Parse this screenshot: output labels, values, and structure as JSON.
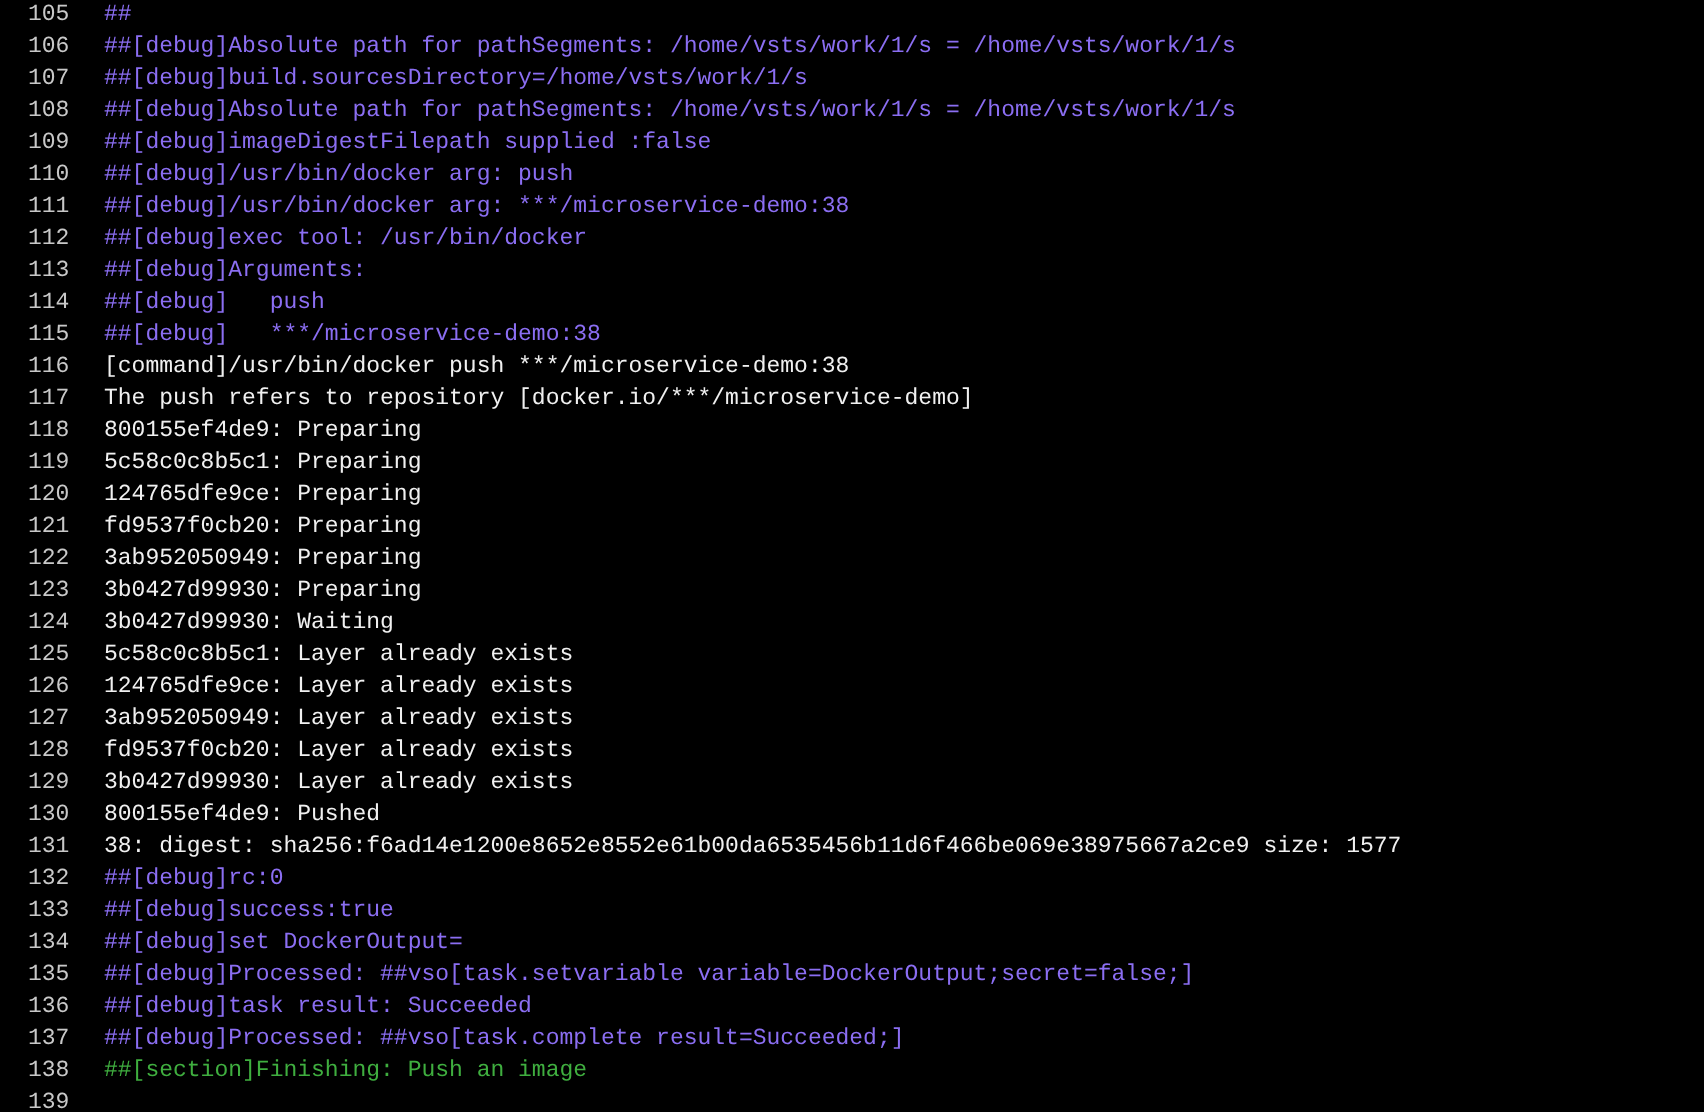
{
  "log_lines": [
    {
      "number": "105",
      "kind": "debug",
      "text": "##"
    },
    {
      "number": "106",
      "kind": "debug",
      "text": "##[debug]Absolute path for pathSegments: /home/vsts/work/1/s = /home/vsts/work/1/s"
    },
    {
      "number": "107",
      "kind": "debug",
      "text": "##[debug]build.sourcesDirectory=/home/vsts/work/1/s"
    },
    {
      "number": "108",
      "kind": "debug",
      "text": "##[debug]Absolute path for pathSegments: /home/vsts/work/1/s = /home/vsts/work/1/s"
    },
    {
      "number": "109",
      "kind": "debug",
      "text": "##[debug]imageDigestFilepath supplied :false"
    },
    {
      "number": "110",
      "kind": "debug",
      "text": "##[debug]/usr/bin/docker arg: push"
    },
    {
      "number": "111",
      "kind": "debug",
      "text": "##[debug]/usr/bin/docker arg: ***/microservice-demo:38"
    },
    {
      "number": "112",
      "kind": "debug",
      "text": "##[debug]exec tool: /usr/bin/docker"
    },
    {
      "number": "113",
      "kind": "debug",
      "text": "##[debug]Arguments:"
    },
    {
      "number": "114",
      "kind": "debug",
      "text": "##[debug]   push"
    },
    {
      "number": "115",
      "kind": "debug",
      "text": "##[debug]   ***/microservice-demo:38"
    },
    {
      "number": "116",
      "kind": "plain",
      "text": "[command]/usr/bin/docker push ***/microservice-demo:38"
    },
    {
      "number": "117",
      "kind": "plain",
      "text": "The push refers to repository [docker.io/***/microservice-demo]"
    },
    {
      "number": "118",
      "kind": "plain",
      "text": "800155ef4de9: Preparing"
    },
    {
      "number": "119",
      "kind": "plain",
      "text": "5c58c0c8b5c1: Preparing"
    },
    {
      "number": "120",
      "kind": "plain",
      "text": "124765dfe9ce: Preparing"
    },
    {
      "number": "121",
      "kind": "plain",
      "text": "fd9537f0cb20: Preparing"
    },
    {
      "number": "122",
      "kind": "plain",
      "text": "3ab952050949: Preparing"
    },
    {
      "number": "123",
      "kind": "plain",
      "text": "3b0427d99930: Preparing"
    },
    {
      "number": "124",
      "kind": "plain",
      "text": "3b0427d99930: Waiting"
    },
    {
      "number": "125",
      "kind": "plain",
      "text": "5c58c0c8b5c1: Layer already exists"
    },
    {
      "number": "126",
      "kind": "plain",
      "text": "124765dfe9ce: Layer already exists"
    },
    {
      "number": "127",
      "kind": "plain",
      "text": "3ab952050949: Layer already exists"
    },
    {
      "number": "128",
      "kind": "plain",
      "text": "fd9537f0cb20: Layer already exists"
    },
    {
      "number": "129",
      "kind": "plain",
      "text": "3b0427d99930: Layer already exists"
    },
    {
      "number": "130",
      "kind": "plain",
      "text": "800155ef4de9: Pushed"
    },
    {
      "number": "131",
      "kind": "plain",
      "text": "38: digest: sha256:f6ad14e1200e8652e8552e61b00da6535456b11d6f466be069e38975667a2ce9 size: 1577"
    },
    {
      "number": "132",
      "kind": "debug",
      "text": "##[debug]rc:0"
    },
    {
      "number": "133",
      "kind": "debug",
      "text": "##[debug]success:true"
    },
    {
      "number": "134",
      "kind": "debug",
      "text": "##[debug]set DockerOutput="
    },
    {
      "number": "135",
      "kind": "debug",
      "text": "##[debug]Processed: ##vso[task.setvariable variable=DockerOutput;secret=false;]"
    },
    {
      "number": "136",
      "kind": "debug",
      "text": "##[debug]task result: Succeeded"
    },
    {
      "number": "137",
      "kind": "debug",
      "text": "##[debug]Processed: ##vso[task.complete result=Succeeded;]"
    },
    {
      "number": "138",
      "kind": "section",
      "text": "##[section]Finishing: Push an image"
    },
    {
      "number": "139"
    }
  ]
}
